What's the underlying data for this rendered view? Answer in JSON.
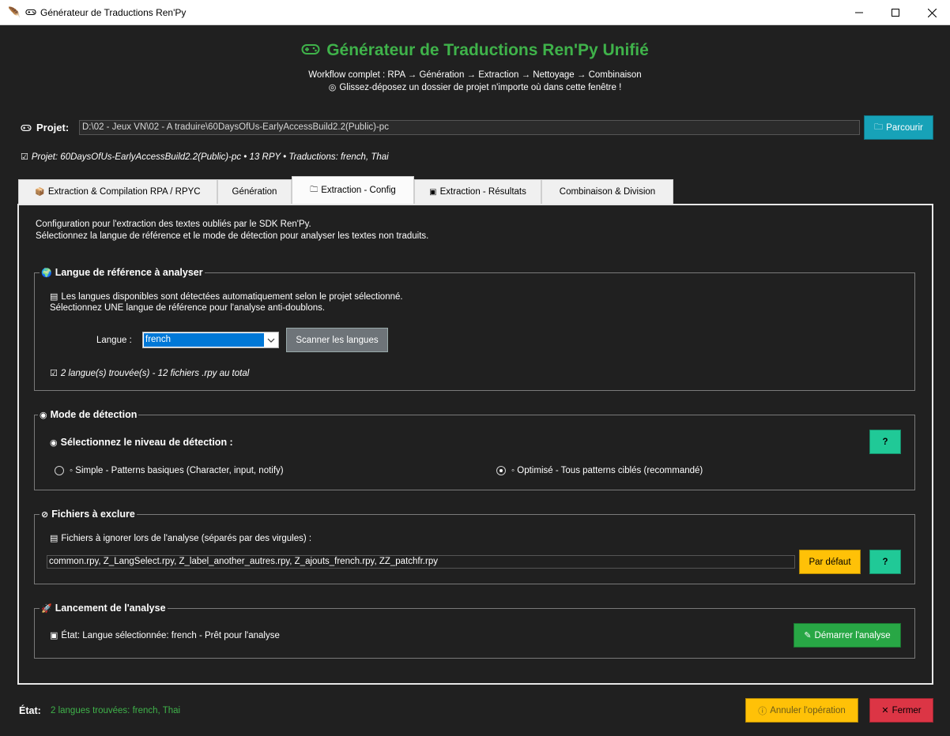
{
  "window": {
    "title": "Générateur de Traductions Ren'Py",
    "minimize": "—",
    "maximize": "☐",
    "close": "✕"
  },
  "header": {
    "title": "Générateur de Traductions Ren'Py Unifié",
    "workflow": "Workflow complet : RPA → Génération → Extraction → Nettoyage → Combinaison",
    "dragdrop": "Glissez-déposez un dossier de projet n'importe où dans cette fenêtre !"
  },
  "project": {
    "label": "Projet:",
    "path": "D:\\02 - Jeux VN\\02 - A traduire\\60DaysOfUs-EarlyAccessBuild2.2(Public)-pc",
    "browse_label": "Parcourir",
    "info": "Projet: 60DaysOfUs-EarlyAccessBuild2.2(Public)-pc • 13 RPY • Traductions: french, Thai"
  },
  "tabs": [
    {
      "label": "Extraction & Compilation RPA / RPYC",
      "icon": "package-icon"
    },
    {
      "label": "Génération",
      "icon": ""
    },
    {
      "label": "Extraction - Config",
      "icon": "folder-icon"
    },
    {
      "label": "Extraction - Résultats",
      "icon": "chart-icon"
    },
    {
      "label": "Combinaison & Division",
      "icon": ""
    }
  ],
  "panel": {
    "desc1": "Configuration pour l'extraction des textes oubliés par le SDK Ren'Py.",
    "desc2": "Sélectionnez la langue de référence et le mode de détection pour analyser les textes non traduits.",
    "lang_group": {
      "title": "Langue de référence à analyser",
      "info1": "Les langues disponibles sont détectées automatiquement selon le projet sélectionné.",
      "info2": "Sélectionnez UNE langue de référence pour l'analyse anti-doublons.",
      "select_label": "Langue :",
      "select_value": "french",
      "scan_label": "Scanner les langues",
      "found": "2 langue(s) trouvée(s) - 12 fichiers .rpy au total"
    },
    "mode_group": {
      "title": "Mode de détection",
      "subtitle": "Sélectionnez le niveau de détection :",
      "help": "?",
      "simple": "◦ Simple - Patterns basiques (Character, input, notify)",
      "optimized": "◦ Optimisé - Tous patterns ciblés (recommandé)",
      "selected": "optimized"
    },
    "exclude_group": {
      "title": "Fichiers à exclure",
      "info": "Fichiers à ignorer lors de l'analyse (séparés par des virgules) :",
      "value": "common.rpy, Z_LangSelect.rpy, Z_label_another_autres.rpy, Z_ajouts_french.rpy, ZZ_patchfr.rpy",
      "default_label": "Par défaut",
      "help": "?"
    },
    "launch_group": {
      "title": "Lancement de l'analyse",
      "status": "État: Langue sélectionnée: french - Prêt pour l'analyse",
      "start_label": "Démarrer l'analyse"
    }
  },
  "footer": {
    "status_label": "État:",
    "status_value": "2 langues trouvées: french, Thai",
    "cancel_label": "Annuler l'opération",
    "close_label": "Fermer"
  },
  "colors": {
    "accent_green": "#3fb24a",
    "browse": "#17a2b8",
    "help": "#20c997",
    "default": "#ffc107",
    "start": "#28a745",
    "close": "#dc3545"
  }
}
